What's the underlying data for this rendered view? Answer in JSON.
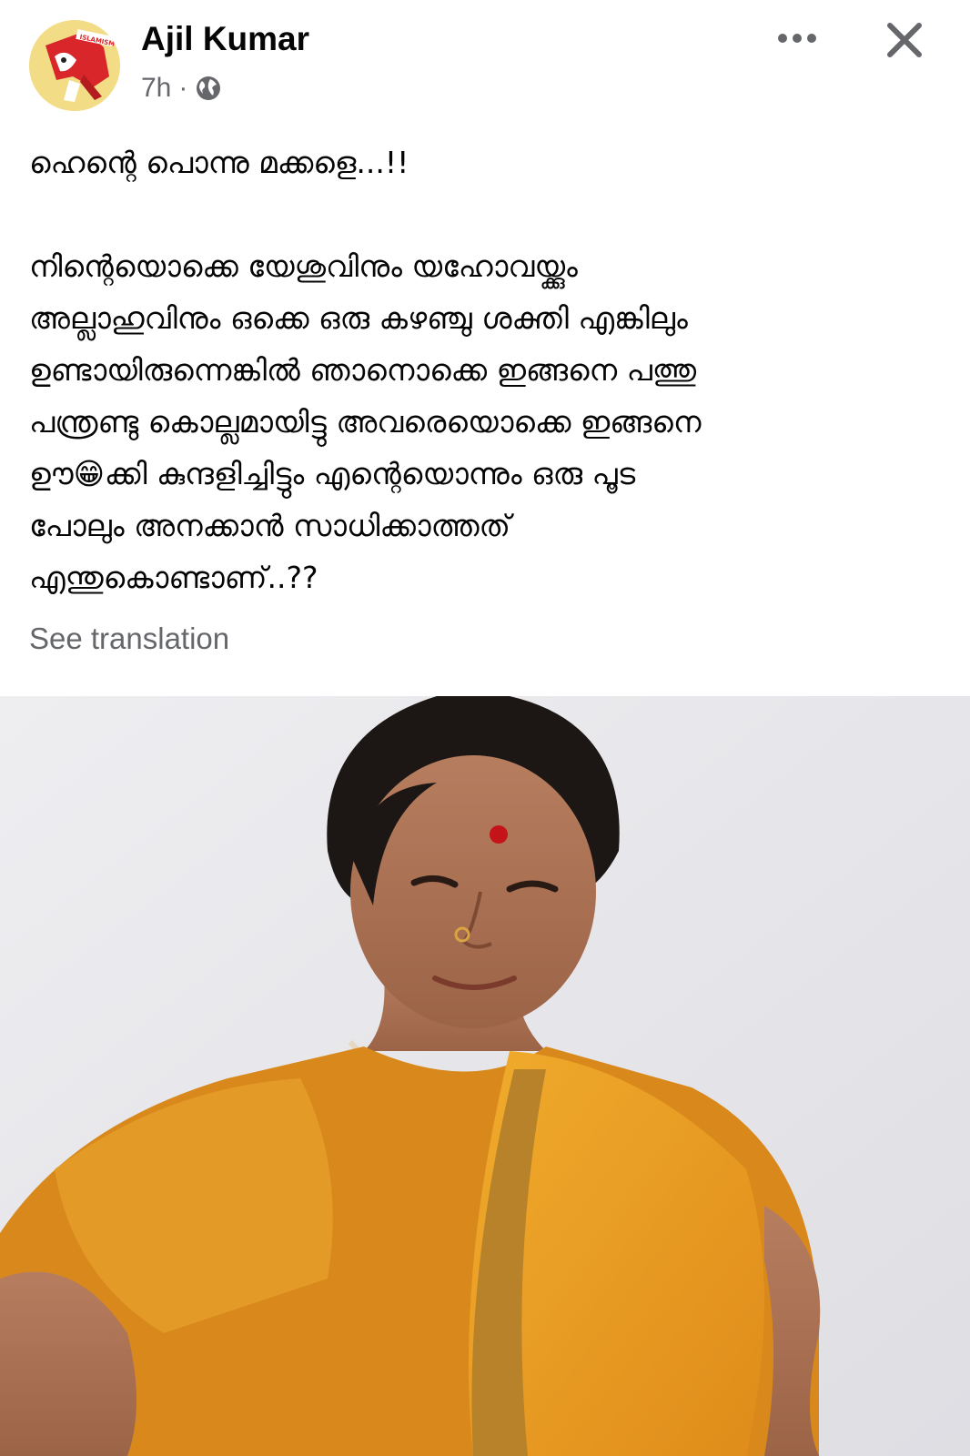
{
  "post": {
    "author": "Ajil Kumar",
    "time": "7h",
    "separator": "·",
    "privacy_icon": "globe-icon",
    "text_lines": [
      "ഹെന്റെ പൊന്നു മക്കളെ...!!",
      "നിന്റെയൊക്കെ യേശുവിനും യഹോവയ്ക്കും",
      "അല്ലാഹുവിനും ഒക്കെ ഒരു കഴഞ്ചു ശക്തി എങ്കിലും",
      "ഉണ്ടായിരുന്നെങ്കിൽ ഞാനൊക്കെ ഇങ്ങനെ പത്തു",
      "പന്ത്രണ്ടു കൊല്ലമായിട്ടു അവരെയൊക്കെ ഇങ്ങനെ",
      "ഊ😁ക്കി കുന്ദളിച്ചിട്ടും എന്റെയൊന്നും ഒരു പൂട",
      "പോലും അനക്കാൻ സാധിക്കാത്തത്",
      "എന്തുകൊണ്ടാണ്..??"
    ],
    "see_translation": "See translation",
    "avatar_text": "ISLAMISM"
  },
  "header": {
    "more_icon": "more-options-icon",
    "close_icon": "close-icon"
  },
  "colors": {
    "text": "#050505",
    "secondary": "#65676b",
    "avatar_bg": "#f2dc86",
    "avatar_accent": "#d8262a",
    "saree": "#e79a22",
    "photo_bg": "#e9e9ec"
  }
}
